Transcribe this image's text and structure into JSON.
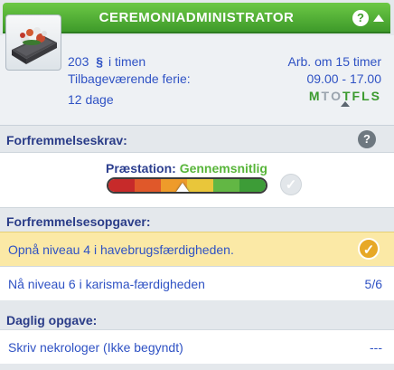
{
  "header": {
    "title": "Ceremoniadministrator",
    "help_glyph": "?",
    "collapse_icon": "chevron-up-icon"
  },
  "career": {
    "icon": "coffin-flowers-icon",
    "pay": "203",
    "simoleon_symbol": "§",
    "pay_unit": "i timen",
    "vacation_label": "Tilbageværende ferie:",
    "vacation_value": "12 dage",
    "work_in": "Arb. om 15 timer",
    "hours": "09.00 - 17.00",
    "days": [
      {
        "letter": "M",
        "work": true
      },
      {
        "letter": "T",
        "work": false
      },
      {
        "letter": "O",
        "work": false
      },
      {
        "letter": "T",
        "work": true
      },
      {
        "letter": "F",
        "work": true
      },
      {
        "letter": "L",
        "work": true
      },
      {
        "letter": "S",
        "work": true
      }
    ]
  },
  "promotion": {
    "heading": "Forfremmelseskrav:",
    "help_glyph": "?",
    "performance_label": "Præstation:",
    "performance_value": "Gennemsnitlig",
    "meter_level": 0.47
  },
  "tasks": {
    "heading": "Forfremmelsesopgaver:",
    "items": [
      {
        "text": "Opnå niveau 4 i havebrugsfærdigheden.",
        "progress": "",
        "done": true
      },
      {
        "text": "Nå niveau 6 i karisma-færdigheden",
        "progress": "5/6",
        "done": false
      }
    ]
  },
  "daily": {
    "heading": "Daglig opgave:",
    "items": [
      {
        "text": "Skriv nekrologer (Ikke begyndt)",
        "progress": "---"
      }
    ]
  },
  "colors": {
    "header_green": "#4fae35",
    "text_blue": "#2f52c4",
    "done_yellow": "#fbe9a6"
  }
}
